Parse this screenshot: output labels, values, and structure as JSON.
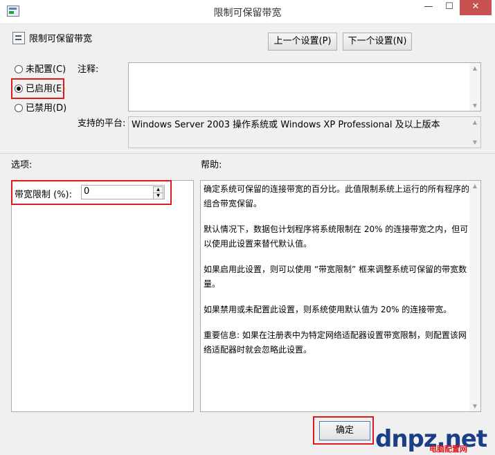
{
  "window": {
    "title": "限制可保留带宽",
    "minimize": "—",
    "maximize": "☐",
    "close": "✕"
  },
  "setting": {
    "name": "限制可保留带宽"
  },
  "nav": {
    "prev": "上一个设置(P)",
    "next": "下一个设置(N)"
  },
  "state": {
    "options": [
      {
        "label": "未配置(C)",
        "selected": false
      },
      {
        "label": "已启用(E)",
        "selected": true
      },
      {
        "label": "已禁用(D)",
        "selected": false
      }
    ]
  },
  "comment": {
    "label": "注释:",
    "value": ""
  },
  "platform": {
    "label": "支持的平台:",
    "value": "Windows Server 2003 操作系统或 Windows XP Professional 及以上版本"
  },
  "options_section": {
    "label": "选项:",
    "bandwidth_label": "带宽限制 (%):",
    "bandwidth_value": "0"
  },
  "help_section": {
    "label": "帮助:",
    "paragraphs": [
      "确定系统可保留的连接带宽的百分比。此值限制系统上运行的所有程序的组合带宽保留。",
      "默认情况下，数据包计划程序将系统限制在 20% 的连接带宽之内，但可以使用此设置来替代默认值。",
      "如果启用此设置，则可以使用 “带宽限制” 框来调整系统可保留的带宽数量。",
      "如果禁用或未配置此设置，则系统使用默认值为 20% 的连接带宽。",
      "重要信息: 如果在注册表中为特定网络适配器设置带宽限制，则配置该网络适配器时就会忽略此设置。"
    ]
  },
  "footer": {
    "ok": "确定"
  },
  "watermark": {
    "text": "dnpz.net",
    "tagline": "电脑配置网"
  },
  "colors": {
    "highlight_box": "#e0191c",
    "close_button": "#c75050"
  }
}
